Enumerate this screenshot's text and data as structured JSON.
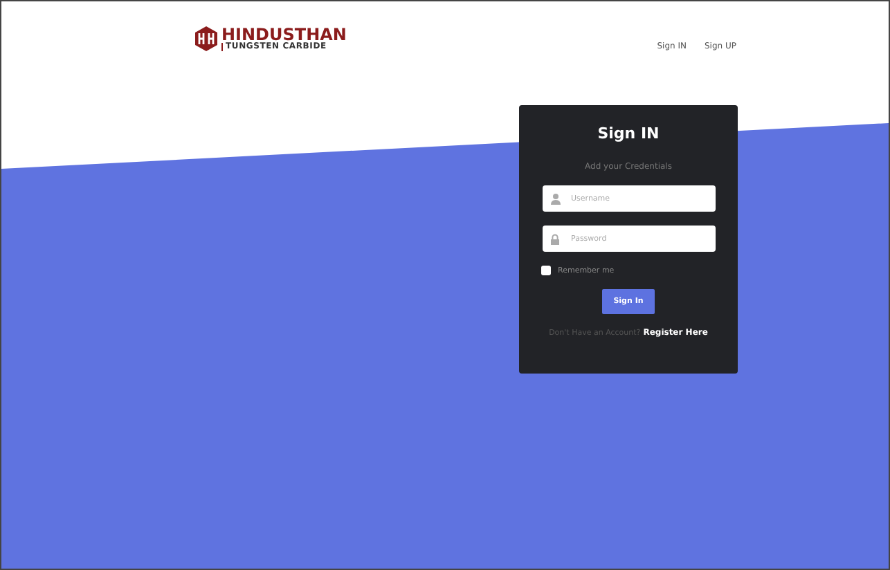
{
  "header": {
    "logo": {
      "title": "HINDUSTHAN",
      "subtitle": "TUNGSTEN CARBIDE"
    },
    "nav": [
      {
        "label": "Sign IN"
      },
      {
        "label": "Sign UP"
      }
    ]
  },
  "login": {
    "title": "Sign IN",
    "subtitle": "Add your Credentials",
    "fields": [
      {
        "kind": "user",
        "placeholder": "Username"
      },
      {
        "kind": "lock",
        "placeholder": "Password"
      }
    ],
    "remember": {
      "label": "Remember me",
      "checked": false
    },
    "button": "Sign In",
    "register": {
      "text": "Don't Have an Account?",
      "link": "Register Here"
    }
  }
}
